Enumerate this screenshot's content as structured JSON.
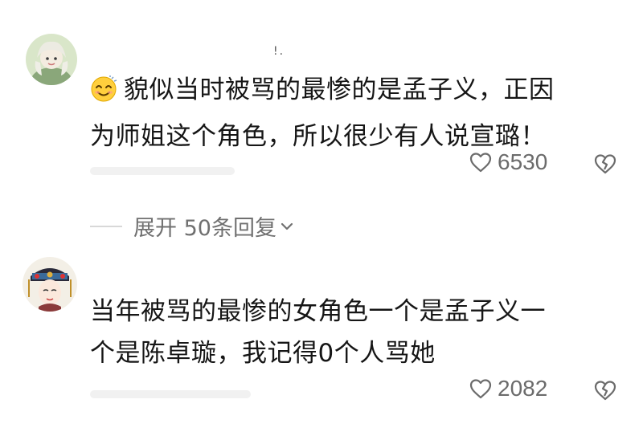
{
  "comments": [
    {
      "username": "!.",
      "emoji": "smiling-face-emoji",
      "text_line1": "貌似当时被骂的最惨的是孟子义，正因",
      "text_line2": "为师姐这个角色，所以很少有人说宣璐！",
      "likes": "6530"
    },
    {
      "text_line1": "当年被骂的最惨的女角色一个是孟子义一",
      "text_line2": "个是陈卓璇，我记得0个人骂她",
      "likes": "2082"
    }
  ],
  "replies": {
    "expand_label": "展开 50条回复"
  },
  "colors": {
    "text": "#161616",
    "meta": "#6b6b6b"
  }
}
